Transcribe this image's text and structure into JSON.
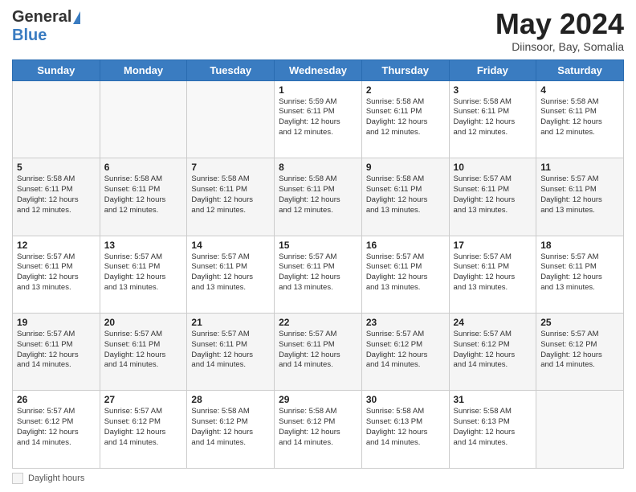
{
  "header": {
    "logo_line1": "General",
    "logo_line2": "Blue",
    "month_title": "May 2024",
    "location": "Diinsoor, Bay, Somalia"
  },
  "footer": {
    "daylight_label": "Daylight hours"
  },
  "calendar": {
    "days_of_week": [
      "Sunday",
      "Monday",
      "Tuesday",
      "Wednesday",
      "Thursday",
      "Friday",
      "Saturday"
    ],
    "weeks": [
      [
        {
          "day": "",
          "info": ""
        },
        {
          "day": "",
          "info": ""
        },
        {
          "day": "",
          "info": ""
        },
        {
          "day": "1",
          "info": "Sunrise: 5:59 AM\nSunset: 6:11 PM\nDaylight: 12 hours\nand 12 minutes."
        },
        {
          "day": "2",
          "info": "Sunrise: 5:58 AM\nSunset: 6:11 PM\nDaylight: 12 hours\nand 12 minutes."
        },
        {
          "day": "3",
          "info": "Sunrise: 5:58 AM\nSunset: 6:11 PM\nDaylight: 12 hours\nand 12 minutes."
        },
        {
          "day": "4",
          "info": "Sunrise: 5:58 AM\nSunset: 6:11 PM\nDaylight: 12 hours\nand 12 minutes."
        }
      ],
      [
        {
          "day": "5",
          "info": "Sunrise: 5:58 AM\nSunset: 6:11 PM\nDaylight: 12 hours\nand 12 minutes."
        },
        {
          "day": "6",
          "info": "Sunrise: 5:58 AM\nSunset: 6:11 PM\nDaylight: 12 hours\nand 12 minutes."
        },
        {
          "day": "7",
          "info": "Sunrise: 5:58 AM\nSunset: 6:11 PM\nDaylight: 12 hours\nand 12 minutes."
        },
        {
          "day": "8",
          "info": "Sunrise: 5:58 AM\nSunset: 6:11 PM\nDaylight: 12 hours\nand 12 minutes."
        },
        {
          "day": "9",
          "info": "Sunrise: 5:58 AM\nSunset: 6:11 PM\nDaylight: 12 hours\nand 13 minutes."
        },
        {
          "day": "10",
          "info": "Sunrise: 5:57 AM\nSunset: 6:11 PM\nDaylight: 12 hours\nand 13 minutes."
        },
        {
          "day": "11",
          "info": "Sunrise: 5:57 AM\nSunset: 6:11 PM\nDaylight: 12 hours\nand 13 minutes."
        }
      ],
      [
        {
          "day": "12",
          "info": "Sunrise: 5:57 AM\nSunset: 6:11 PM\nDaylight: 12 hours\nand 13 minutes."
        },
        {
          "day": "13",
          "info": "Sunrise: 5:57 AM\nSunset: 6:11 PM\nDaylight: 12 hours\nand 13 minutes."
        },
        {
          "day": "14",
          "info": "Sunrise: 5:57 AM\nSunset: 6:11 PM\nDaylight: 12 hours\nand 13 minutes."
        },
        {
          "day": "15",
          "info": "Sunrise: 5:57 AM\nSunset: 6:11 PM\nDaylight: 12 hours\nand 13 minutes."
        },
        {
          "day": "16",
          "info": "Sunrise: 5:57 AM\nSunset: 6:11 PM\nDaylight: 12 hours\nand 13 minutes."
        },
        {
          "day": "17",
          "info": "Sunrise: 5:57 AM\nSunset: 6:11 PM\nDaylight: 12 hours\nand 13 minutes."
        },
        {
          "day": "18",
          "info": "Sunrise: 5:57 AM\nSunset: 6:11 PM\nDaylight: 12 hours\nand 13 minutes."
        }
      ],
      [
        {
          "day": "19",
          "info": "Sunrise: 5:57 AM\nSunset: 6:11 PM\nDaylight: 12 hours\nand 14 minutes."
        },
        {
          "day": "20",
          "info": "Sunrise: 5:57 AM\nSunset: 6:11 PM\nDaylight: 12 hours\nand 14 minutes."
        },
        {
          "day": "21",
          "info": "Sunrise: 5:57 AM\nSunset: 6:11 PM\nDaylight: 12 hours\nand 14 minutes."
        },
        {
          "day": "22",
          "info": "Sunrise: 5:57 AM\nSunset: 6:11 PM\nDaylight: 12 hours\nand 14 minutes."
        },
        {
          "day": "23",
          "info": "Sunrise: 5:57 AM\nSunset: 6:12 PM\nDaylight: 12 hours\nand 14 minutes."
        },
        {
          "day": "24",
          "info": "Sunrise: 5:57 AM\nSunset: 6:12 PM\nDaylight: 12 hours\nand 14 minutes."
        },
        {
          "day": "25",
          "info": "Sunrise: 5:57 AM\nSunset: 6:12 PM\nDaylight: 12 hours\nand 14 minutes."
        }
      ],
      [
        {
          "day": "26",
          "info": "Sunrise: 5:57 AM\nSunset: 6:12 PM\nDaylight: 12 hours\nand 14 minutes."
        },
        {
          "day": "27",
          "info": "Sunrise: 5:57 AM\nSunset: 6:12 PM\nDaylight: 12 hours\nand 14 minutes."
        },
        {
          "day": "28",
          "info": "Sunrise: 5:58 AM\nSunset: 6:12 PM\nDaylight: 12 hours\nand 14 minutes."
        },
        {
          "day": "29",
          "info": "Sunrise: 5:58 AM\nSunset: 6:12 PM\nDaylight: 12 hours\nand 14 minutes."
        },
        {
          "day": "30",
          "info": "Sunrise: 5:58 AM\nSunset: 6:13 PM\nDaylight: 12 hours\nand 14 minutes."
        },
        {
          "day": "31",
          "info": "Sunrise: 5:58 AM\nSunset: 6:13 PM\nDaylight: 12 hours\nand 14 minutes."
        },
        {
          "day": "",
          "info": ""
        }
      ]
    ]
  }
}
